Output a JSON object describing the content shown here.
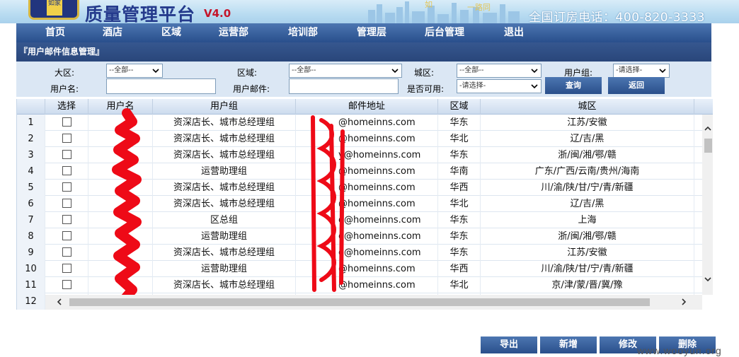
{
  "header": {
    "logo_text": "如家",
    "title": "质量管理平台",
    "version": "V4.0",
    "phone": "全国订房电话：400-820-3333"
  },
  "nav": {
    "items": [
      "首页",
      "酒店",
      "区域",
      "运营部",
      "培训部",
      "管理层",
      "后台管理",
      "退出"
    ]
  },
  "panel": {
    "title": "『用户邮件信息管理』"
  },
  "filters": {
    "region_label": "大区:",
    "region_value": "--全部--",
    "area_label": "区域:",
    "area_value": "--全部--",
    "city_label": "城区:",
    "city_value": "--全部--",
    "group_label": "用户组:",
    "group_value": "-请选择-",
    "username_label": "用户名:",
    "username_value": "",
    "email_label": "用户邮件:",
    "email_value": "",
    "enabled_label": "是否可用:",
    "enabled_value": "-请选择-",
    "search_button": "查询",
    "back_button": "返回"
  },
  "table": {
    "columns": [
      "选择",
      "用户名",
      "用户组",
      "邮件地址",
      "区域",
      "城区"
    ],
    "rows": [
      {
        "num": "1",
        "group": "资深店长、城市总经理组",
        "email": "@homeinns.com",
        "region": "华东",
        "city": "江苏/安徽"
      },
      {
        "num": "2",
        "group": "资深店长、城市总经理组",
        "email": "@homeinns.com",
        "region": "华北",
        "city": "辽/吉/黑"
      },
      {
        "num": "3",
        "group": "资深店长、城市总经理组",
        "email": "y@homeinns.com",
        "region": "华东",
        "city": "浙/闽/湘/鄂/赣"
      },
      {
        "num": "4",
        "group": "运营助理组",
        "email": "@homeinns.com",
        "region": "华南",
        "city": "广东/广西/云南/贵州/海南"
      },
      {
        "num": "5",
        "group": "资深店长、城市总经理组",
        "email": "@homeinns.com",
        "region": "华西",
        "city": "川/渝/陕/甘/宁/青/新疆"
      },
      {
        "num": "6",
        "group": "资深店长、城市总经理组",
        "email": "@homeinns.com",
        "region": "华北",
        "city": "辽/吉/黑"
      },
      {
        "num": "7",
        "group": "区总组",
        "email": "o@homeinns.com",
        "region": "华东",
        "city": "上海"
      },
      {
        "num": "8",
        "group": "运营助理组",
        "email": "o@homeinns.com",
        "region": "华东",
        "city": "浙/闽/湘/鄂/赣"
      },
      {
        "num": "9",
        "group": "资深店长、城市总经理组",
        "email": "o@homeinns.com",
        "region": "华东",
        "city": "江苏/安徽"
      },
      {
        "num": "10",
        "group": "运营助理组",
        "email": "@homeinns.com",
        "region": "华西",
        "city": "川/渝/陕/甘/宁/青/新疆"
      },
      {
        "num": "11",
        "group": "资深店长、城市总经理组",
        "email": "@homeinns.com",
        "region": "华北",
        "city": "京/津/蒙/晋/冀/豫"
      },
      {
        "num": "12",
        "group": "",
        "email": "",
        "region": "",
        "city": ""
      }
    ]
  },
  "actions": {
    "export": "导出",
    "add": "新增",
    "edit": "修改",
    "delete": "删除"
  },
  "watermark": "www.wooyun.org"
}
